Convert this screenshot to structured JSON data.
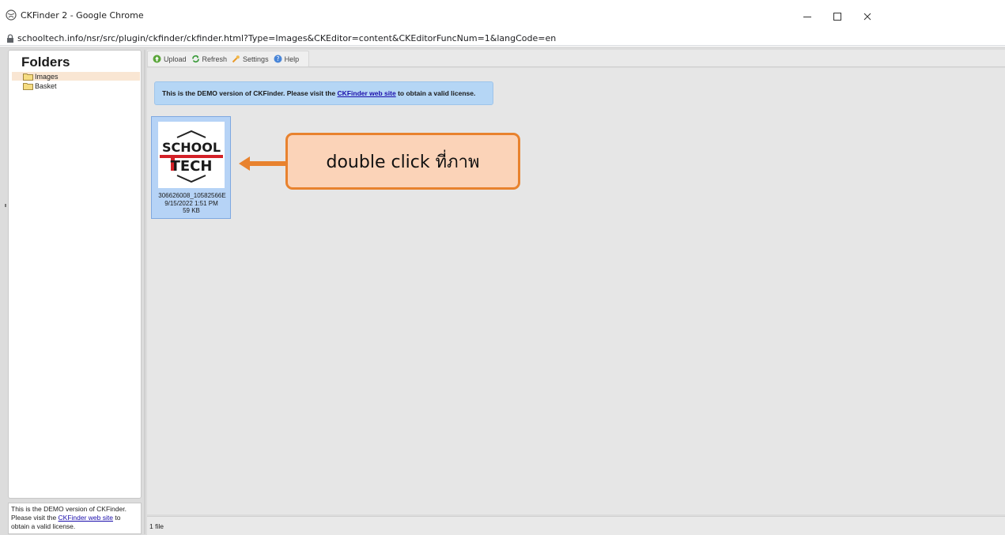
{
  "window": {
    "title": "CKFinder 2 - Google Chrome",
    "minimize_label": "–",
    "maximize_label": "□",
    "close_label": "×"
  },
  "address_bar": {
    "url": "schooltech.info/nsr/src/plugin/ckfinder/ckfinder.html?Type=Images&CKEditor=content&CKEditorFuncNum=1&langCode=en"
  },
  "sidebar": {
    "title": "Folders",
    "folders": [
      {
        "label": "Images",
        "selected": true
      },
      {
        "label": "Basket",
        "selected": false
      }
    ],
    "demo_text_before": "This is the DEMO version of CKFinder. Please visit the ",
    "demo_link": "CKFinder web site",
    "demo_text_after": " to obtain a valid license."
  },
  "toolbar": {
    "upload_label": "Upload",
    "refresh_label": "Refresh",
    "settings_label": "Settings",
    "help_label": "Help"
  },
  "main": {
    "demo_text_before": "This is the DEMO version of CKFinder. Please visit the ",
    "demo_link": "CKFinder web site",
    "demo_text_after": " to obtain a valid license.",
    "files": [
      {
        "name": "306626008_10582566E",
        "date": "9/15/2022 1:51 PM",
        "size": "59 KB",
        "thumb_line1": "SCHOOL",
        "thumb_line2": "TECH"
      }
    ]
  },
  "annotation": {
    "text": "double click ที่ภาพ"
  },
  "statusbar": {
    "text": "1 file"
  },
  "colors": {
    "accent_orange": "#e8822e",
    "callout_fill": "#fbd3b8",
    "selection_blue": "#b6d3f6",
    "demo_blue": "#b5d6f5",
    "logo_red": "#d32027"
  }
}
